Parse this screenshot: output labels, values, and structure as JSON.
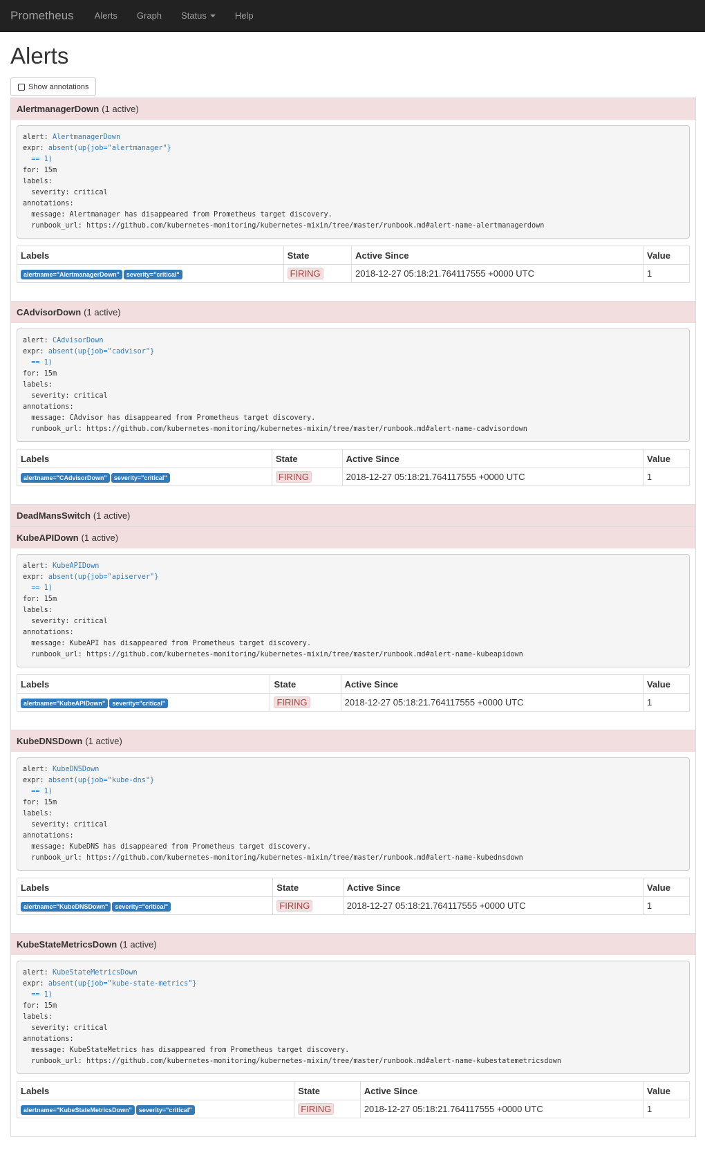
{
  "nav": {
    "brand": "Prometheus",
    "items": [
      "Alerts",
      "Graph",
      "Status",
      "Help"
    ]
  },
  "page_title": "Alerts",
  "show_annotations_label": "Show annotations",
  "table_headers": {
    "labels": "Labels",
    "state": "State",
    "active_since": "Active Since",
    "value": "Value"
  },
  "alerts": [
    {
      "name": "AlertmanagerDown",
      "count": "(1 active)",
      "rule": {
        "alert": "AlertmanagerDown",
        "expr_line1": "absent(up{job=\"alertmanager\"}",
        "expr_line2": "  == 1)",
        "for": "15m",
        "severity": "critical",
        "message": "Alertmanager has disappeared from Prometheus target discovery.",
        "runbook_url": "https://github.com/kubernetes-monitoring/kubernetes-mixin/tree/master/runbook.md#alert-name-alertmanagerdown"
      },
      "instance": {
        "label_alertname": "alertname=\"AlertmanagerDown\"",
        "label_severity": "severity=\"critical\"",
        "state": "FIRING",
        "active_since": "2018-12-27 05:18:21.764117555 +0000 UTC",
        "value": "1"
      }
    },
    {
      "name": "CAdvisorDown",
      "count": "(1 active)",
      "rule": {
        "alert": "CAdvisorDown",
        "expr_line1": "absent(up{job=\"cadvisor\"}",
        "expr_line2": "  == 1)",
        "for": "15m",
        "severity": "critical",
        "message": "CAdvisor has disappeared from Prometheus target discovery.",
        "runbook_url": "https://github.com/kubernetes-monitoring/kubernetes-mixin/tree/master/runbook.md#alert-name-cadvisordown"
      },
      "instance": {
        "label_alertname": "alertname=\"CAdvisorDown\"",
        "label_severity": "severity=\"critical\"",
        "state": "FIRING",
        "active_since": "2018-12-27 05:18:21.764117555 +0000 UTC",
        "value": "1"
      }
    },
    {
      "name": "DeadMansSwitch",
      "count": "(1 active)"
    },
    {
      "name": "KubeAPIDown",
      "count": "(1 active)",
      "rule": {
        "alert": "KubeAPIDown",
        "expr_line1": "absent(up{job=\"apiserver\"}",
        "expr_line2": "  == 1)",
        "for": "15m",
        "severity": "critical",
        "message": "KubeAPI has disappeared from Prometheus target discovery.",
        "runbook_url": "https://github.com/kubernetes-monitoring/kubernetes-mixin/tree/master/runbook.md#alert-name-kubeapidown"
      },
      "instance": {
        "label_alertname": "alertname=\"KubeAPIDown\"",
        "label_severity": "severity=\"critical\"",
        "state": "FIRING",
        "active_since": "2018-12-27 05:18:21.764117555 +0000 UTC",
        "value": "1"
      }
    },
    {
      "name": "KubeDNSDown",
      "count": "(1 active)",
      "rule": {
        "alert": "KubeDNSDown",
        "expr_line1": "absent(up{job=\"kube-dns\"}",
        "expr_line2": "  == 1)",
        "for": "15m",
        "severity": "critical",
        "message": "KubeDNS has disappeared from Prometheus target discovery.",
        "runbook_url": "https://github.com/kubernetes-monitoring/kubernetes-mixin/tree/master/runbook.md#alert-name-kubednsdown"
      },
      "instance": {
        "label_alertname": "alertname=\"KubeDNSDown\"",
        "label_severity": "severity=\"critical\"",
        "state": "FIRING",
        "active_since": "2018-12-27 05:18:21.764117555 +0000 UTC",
        "value": "1"
      }
    },
    {
      "name": "KubeStateMetricsDown",
      "count": "(1 active)",
      "rule": {
        "alert": "KubeStateMetricsDown",
        "expr_line1": "absent(up{job=\"kube-state-metrics\"}",
        "expr_line2": "  == 1)",
        "for": "15m",
        "severity": "critical",
        "message": "KubeStateMetrics has disappeared from Prometheus target discovery.",
        "runbook_url": "https://github.com/kubernetes-monitoring/kubernetes-mixin/tree/master/runbook.md#alert-name-kubestatemetricsdown"
      },
      "instance": {
        "label_alertname": "alertname=\"KubeStateMetricsDown\"",
        "label_severity": "severity=\"critical\"",
        "state": "FIRING",
        "active_since": "2018-12-27 05:18:21.764117555 +0000 UTC",
        "value": "1"
      }
    }
  ]
}
